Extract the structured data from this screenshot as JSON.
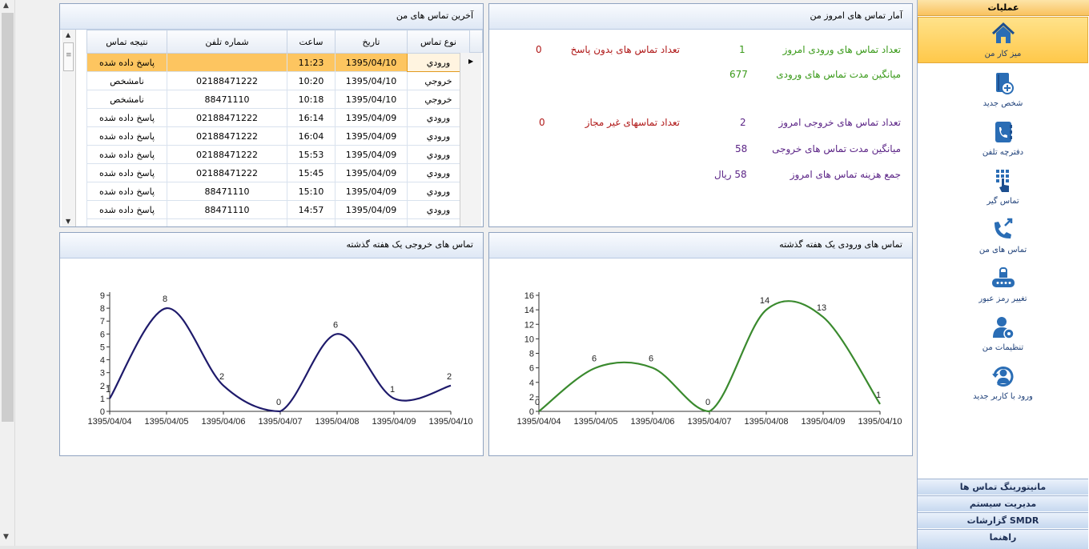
{
  "colors": {
    "accent": "#fdc560",
    "incoming_line": "#3a8a2e",
    "outgoing_line": "#1e1a6b",
    "green_text": "#3a9a1a",
    "red_text": "#b01818",
    "purple_text": "#5b2486"
  },
  "stats": {
    "title": "آمار تماس های امروز من",
    "incoming_count_label": "تعداد تماس های ورودی امروز",
    "incoming_count_value": "1",
    "unanswered_label": "تعداد تماس های بدون پاسخ",
    "unanswered_value": "0",
    "avg_incoming_label": "میانگین مدت تماس های ورودی",
    "avg_incoming_value": "677",
    "outgoing_count_label": "تعداد تماس های خروجی امروز",
    "outgoing_count_value": "2",
    "unauthorized_label": "تعداد تماسهای غیر مجاز",
    "unauthorized_value": "0",
    "avg_outgoing_label": "میانگین مدت تماس های خروجی",
    "avg_outgoing_value": "58",
    "cost_label": "جمع هزینه تماس های امروز",
    "cost_value": "58 ریال"
  },
  "recent": {
    "title": "آخرین تماس های من",
    "columns": [
      "نوع تماس",
      "تاریخ",
      "ساعت",
      "شماره تلفن",
      "نتیجه تماس"
    ],
    "rows": [
      [
        "ورودي",
        "1395/04/10",
        "11:23",
        "",
        "پاسخ داده شده"
      ],
      [
        "خروجي",
        "1395/04/10",
        "10:20",
        "02188471222",
        "نامشخص"
      ],
      [
        "خروجي",
        "1395/04/10",
        "10:18",
        "88471110",
        "نامشخص"
      ],
      [
        "ورودي",
        "1395/04/09",
        "16:14",
        "02188471222",
        "پاسخ داده شده"
      ],
      [
        "ورودي",
        "1395/04/09",
        "16:04",
        "02188471222",
        "پاسخ داده شده"
      ],
      [
        "ورودي",
        "1395/04/09",
        "15:53",
        "02188471222",
        "پاسخ داده شده"
      ],
      [
        "ورودي",
        "1395/04/09",
        "15:45",
        "02188471222",
        "پاسخ داده شده"
      ],
      [
        "ورودي",
        "1395/04/09",
        "15:10",
        "88471110",
        "پاسخ داده شده"
      ],
      [
        "ورودي",
        "1395/04/09",
        "14:57",
        "88471110",
        "پاسخ داده شده"
      ]
    ]
  },
  "charts": {
    "incoming_title": "تماس های ورودی یک هفته گذشته",
    "outgoing_title": "تماس های خروجی یک هفته گذشته"
  },
  "chart_data": [
    {
      "type": "line",
      "title": "تماس های ورودی یک هفته گذشته",
      "categories": [
        "1395/04/04",
        "1395/04/05",
        "1395/04/06",
        "1395/04/07",
        "1395/04/08",
        "1395/04/09",
        "1395/04/10"
      ],
      "values": [
        0,
        6,
        6,
        0,
        14,
        13,
        1
      ],
      "ylim": [
        0,
        16
      ],
      "yticks": [
        "0",
        "2",
        "4",
        "6",
        "8",
        "10",
        "12",
        "14",
        "16"
      ],
      "color": "#3a8a2e"
    },
    {
      "type": "line",
      "title": "تماس های خروجی یک هفته گذشته",
      "categories": [
        "1395/04/04",
        "1395/04/05",
        "1395/04/06",
        "1395/04/07",
        "1395/04/08",
        "1395/04/09",
        "1395/04/10"
      ],
      "values": [
        1,
        8,
        2,
        0,
        6,
        1,
        2
      ],
      "ylim": [
        0,
        9
      ],
      "yticks": [
        "0",
        "1",
        "2",
        "3",
        "4",
        "5",
        "6",
        "7",
        "8",
        "9"
      ],
      "color": "#1e1a6b"
    }
  ],
  "sidebar": {
    "header": "عملیات",
    "items": [
      {
        "label": "میز کار من",
        "icon": "home-icon"
      },
      {
        "label": "شخص جدید",
        "icon": "add-contact-icon"
      },
      {
        "label": "دفترچه تلفن",
        "icon": "phonebook-icon"
      },
      {
        "label": "تماس گیر",
        "icon": "dialpad-icon"
      },
      {
        "label": "تماس های من",
        "icon": "my-calls-icon"
      },
      {
        "label": "تغییر رمز عبور",
        "icon": "password-icon"
      },
      {
        "label": "تنظیمات من",
        "icon": "user-settings-icon"
      },
      {
        "label": "ورود با کاربر جدید",
        "icon": "switch-user-icon"
      }
    ],
    "bottom": [
      "مانیتورینگ تماس ها",
      "مدیریت سیستم",
      "گزارشات SMDR",
      "راهنما"
    ]
  }
}
